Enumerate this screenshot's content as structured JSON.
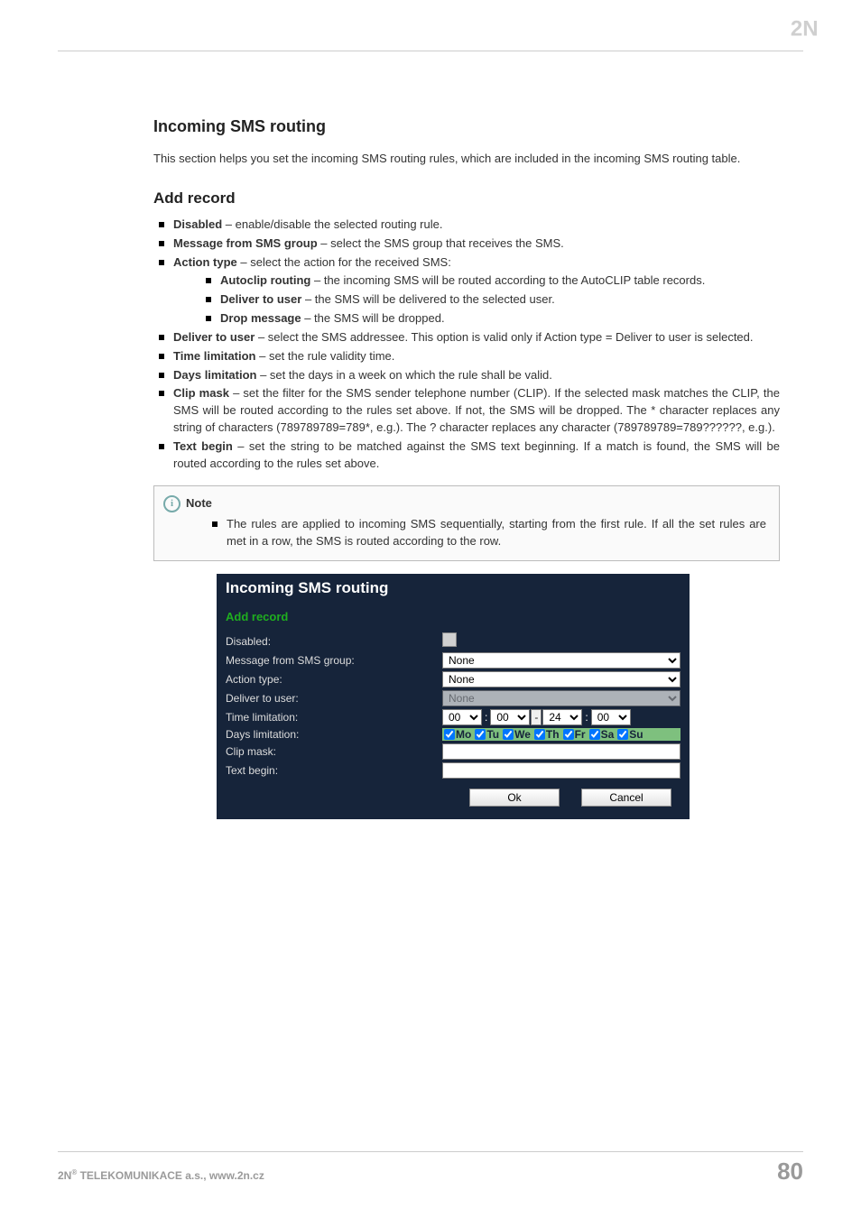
{
  "logo_alt": "2N",
  "section_title": "Incoming SMS routing",
  "intro_para": "This section helps you set the incoming SMS routing rules, which are included in the incoming SMS routing table.",
  "sub_title": "Add record",
  "bullets": {
    "disabled": {
      "term": "Disabled",
      "rest": " – enable/disable the selected routing rule."
    },
    "msg_group": {
      "term": "Message from SMS group",
      "rest": " – select the SMS group that receives the SMS."
    },
    "action_type": {
      "term": "Action type",
      "rest": " –  select the action for the received SMS:"
    },
    "action_children": {
      "autoclip": {
        "term": "Autoclip routing",
        "rest": " – the incoming SMS will be routed according to the AutoCLIP table records."
      },
      "deliver": {
        "term": "Deliver to user",
        "rest": " – the SMS will be delivered to the selected user."
      },
      "drop": {
        "term": "Drop message",
        "rest": " – the SMS will be dropped."
      }
    },
    "deliver_user": {
      "term": "Deliver to user",
      "rest": " – select the SMS addressee. This option is valid only if Action type = Deliver to user is selected."
    },
    "time_lim": {
      "term": "Time limitation",
      "rest": " –  set the rule validity time."
    },
    "days_lim": {
      "term": "Days limitation",
      "rest": " –  set the days in a week on which the rule shall be valid."
    },
    "clip_mask": {
      "term": "Clip mask",
      "rest": " – set the filter for the SMS sender telephone number (CLIP). If the selected mask matches the CLIP, the SMS will be routed according to the rules set above. If not, the SMS will be dropped. The * character replaces any string of characters (789789789=789*, e.g.). The ? character replaces any character (789789789=789??????, e.g.)."
    },
    "text_begin": {
      "term": "Text begin",
      "rest": " – set the string to be matched against the SMS text beginning. If a match is found, the SMS will be routed according to the rules set above."
    }
  },
  "note": {
    "title": "Note",
    "icon": "i",
    "text": "The rules are applied to incoming SMS sequentially, starting from the first rule. If all the set rules are met in a row, the SMS is routed according to the row."
  },
  "dialog": {
    "title": "Incoming SMS routing",
    "subtitle": "Add record",
    "labels": {
      "disabled": "Disabled:",
      "msg_group": "Message from SMS group:",
      "action_type": "Action type:",
      "deliver": "Deliver to user:",
      "time_lim": "Time limitation:",
      "days_lim": "Days limitation:",
      "clip": "Clip mask:",
      "text_begin": "Text begin:"
    },
    "values": {
      "msg_group": "None",
      "action_type": "None",
      "deliver": "None",
      "time": {
        "h1": "00",
        "m1": "00",
        "sep": "-",
        "h2": "24",
        "m2": "00"
      }
    },
    "days": [
      "Mo",
      "Tu",
      "We",
      "Th",
      "Fr",
      "Sa",
      "Su"
    ],
    "buttons": {
      "ok": "Ok",
      "cancel": "Cancel"
    }
  },
  "footer": {
    "left_pre": "2N",
    "left_sup": "®",
    "left_rest": " TELEKOMUNIKACE a.s., www.2n.cz",
    "page": "80"
  }
}
